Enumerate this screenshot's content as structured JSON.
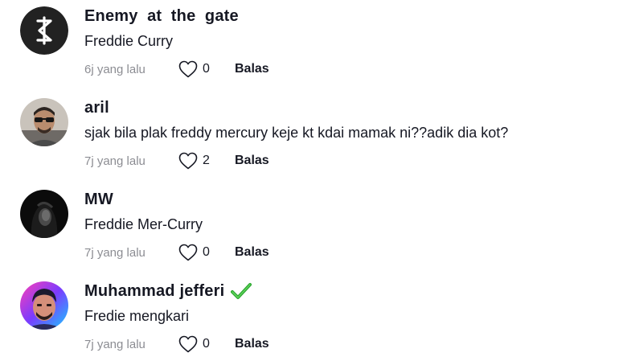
{
  "comments": [
    {
      "username": "Enemy  at  the  gate",
      "text": "Freddie Curry",
      "time": "6j yang lalu",
      "likes": "0",
      "reply": "Balas",
      "verified": false
    },
    {
      "username": "aril",
      "text": "sjak bila plak freddy mercury keje kt kdai mamak ni??adik dia kot?",
      "time": "7j yang lalu",
      "likes": "2",
      "reply": "Balas",
      "verified": false
    },
    {
      "username": "MW",
      "text": "Freddie Mer-Curry",
      "time": "7j yang lalu",
      "likes": "0",
      "reply": "Balas",
      "verified": false
    },
    {
      "username": "Muhammad jefferi",
      "text": "Fredie mengkari",
      "time": "7j yang lalu",
      "likes": "0",
      "reply": "Balas",
      "verified": true
    }
  ],
  "colors": {
    "text": "#161823",
    "muted": "#8a8b91",
    "verified": "#2aa52f"
  },
  "icons": {
    "like": "heart-outline-icon",
    "verified": "check-icon"
  }
}
